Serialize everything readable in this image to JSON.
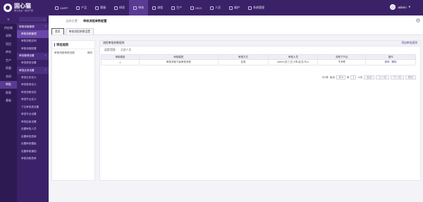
{
  "header": {
    "logo_title": "固心猫",
    "logo_subtitle": "助力企业一站式产研",
    "nav": [
      {
        "label": "OAPP",
        "active": false
      },
      {
        "label": "产品",
        "active": false
      },
      {
        "label": "客服",
        "active": false
      },
      {
        "label": "研发",
        "active": false
      },
      {
        "label": "审核",
        "active": true
      },
      {
        "label": "流程",
        "active": false
      },
      {
        "label": "生产",
        "active": false
      },
      {
        "label": "OKO",
        "active": false
      },
      {
        "label": "人员",
        "active": false
      },
      {
        "label": "维护",
        "active": false
      },
      {
        "label": "系统管理",
        "active": false
      }
    ],
    "user": "admin"
  },
  "rail": {
    "toggle": "≡",
    "items": [
      "供应商",
      "采购",
      "项目",
      "库存",
      "生产",
      "质量",
      "合同",
      "审批",
      "报表",
      "基础"
    ],
    "active_index": 7
  },
  "submenu": {
    "search_icon": "search-icon",
    "groups": [
      {
        "label": "审核流程管理",
        "items": [
          "审核流程管理",
          "审核流程实例",
          "审核流程配置"
        ]
      },
      {
        "label": "审批管理设置",
        "items": [
          "审批类型设置"
        ]
      },
      {
        "label": "审批业务设置",
        "items": [
          "审批业务定义",
          "审批表单定义",
          "审批流程设定",
          "审批节点定义",
          "下达审批表设置",
          "审批节点设置",
          "审批结束设置",
          "设置审批人员",
          "设置审批表单",
          "设置审批模板",
          "设置审核通知",
          "审核流程表单"
        ]
      }
    ],
    "active_item": "审核流程管理"
  },
  "breadcrumb": {
    "prefix": "当前位置：",
    "current": "审核流程参数配置"
  },
  "tabs": [
    {
      "label": "首页",
      "active": true
    },
    {
      "label": "审核流程参数设置",
      "active": false
    }
  ],
  "left_panel": {
    "title": "审批规则",
    "rows": [
      {
        "label": "审核流程审核流程",
        "action": "修改"
      }
    ]
  },
  "right_panel": {
    "title": "流程审批参数规则",
    "link": "添加审批规则",
    "filter_label": "适用范围：",
    "filter_value": "全部人员",
    "columns": [
      "审核模型",
      "审核模型",
      "审核方式",
      "审核人员",
      "关联下节点",
      "操作"
    ],
    "rows": [
      {
        "id": "1",
        "model": "审核流程下级审核流程",
        "method": "会签",
        "people": "admin,张三/王小李,赵五/马六",
        "next": "不关联",
        "ops": [
          "修改",
          "删除"
        ]
      }
    ],
    "pager": {
      "total": "共1条",
      "per_page_label": "每页",
      "per_page": "10",
      "unit": "条",
      "page": "1",
      "pages": "/1页",
      "buttons": [
        "首页",
        "上一页",
        "下一页",
        "尾页"
      ]
    }
  }
}
